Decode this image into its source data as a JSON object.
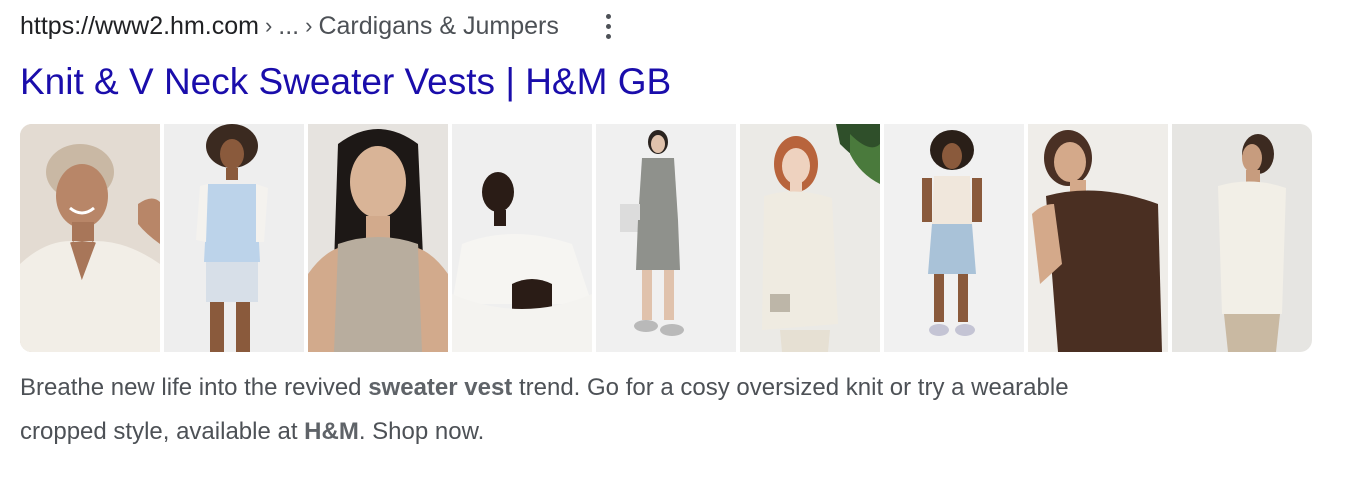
{
  "result": {
    "url": {
      "domain": "https://www2.hm.com",
      "sep1": "›",
      "ellipsis": "...",
      "sep2": "›",
      "crumb": "Cardigans & Jumpers"
    },
    "more_icon": "three-dot-vertical-icon",
    "title": "Knit & V Neck Sweater Vests | H&M GB",
    "images": [
      {
        "alt": "model-1"
      },
      {
        "alt": "model-2"
      },
      {
        "alt": "model-3"
      },
      {
        "alt": "model-4"
      },
      {
        "alt": "model-5"
      },
      {
        "alt": "model-6"
      },
      {
        "alt": "model-7"
      },
      {
        "alt": "model-8"
      },
      {
        "alt": "model-9"
      }
    ],
    "snippet": {
      "part1": "Breathe new life into the revived ",
      "bold1": "sweater vest",
      "part2": " trend. Go for a cosy oversized knit or try a wearable cropped style, available at ",
      "bold2": "H&M",
      "part3": ". Shop now."
    }
  },
  "colors": {
    "link": "#1a0dab",
    "text": "#4d5156",
    "url": "#202124"
  }
}
